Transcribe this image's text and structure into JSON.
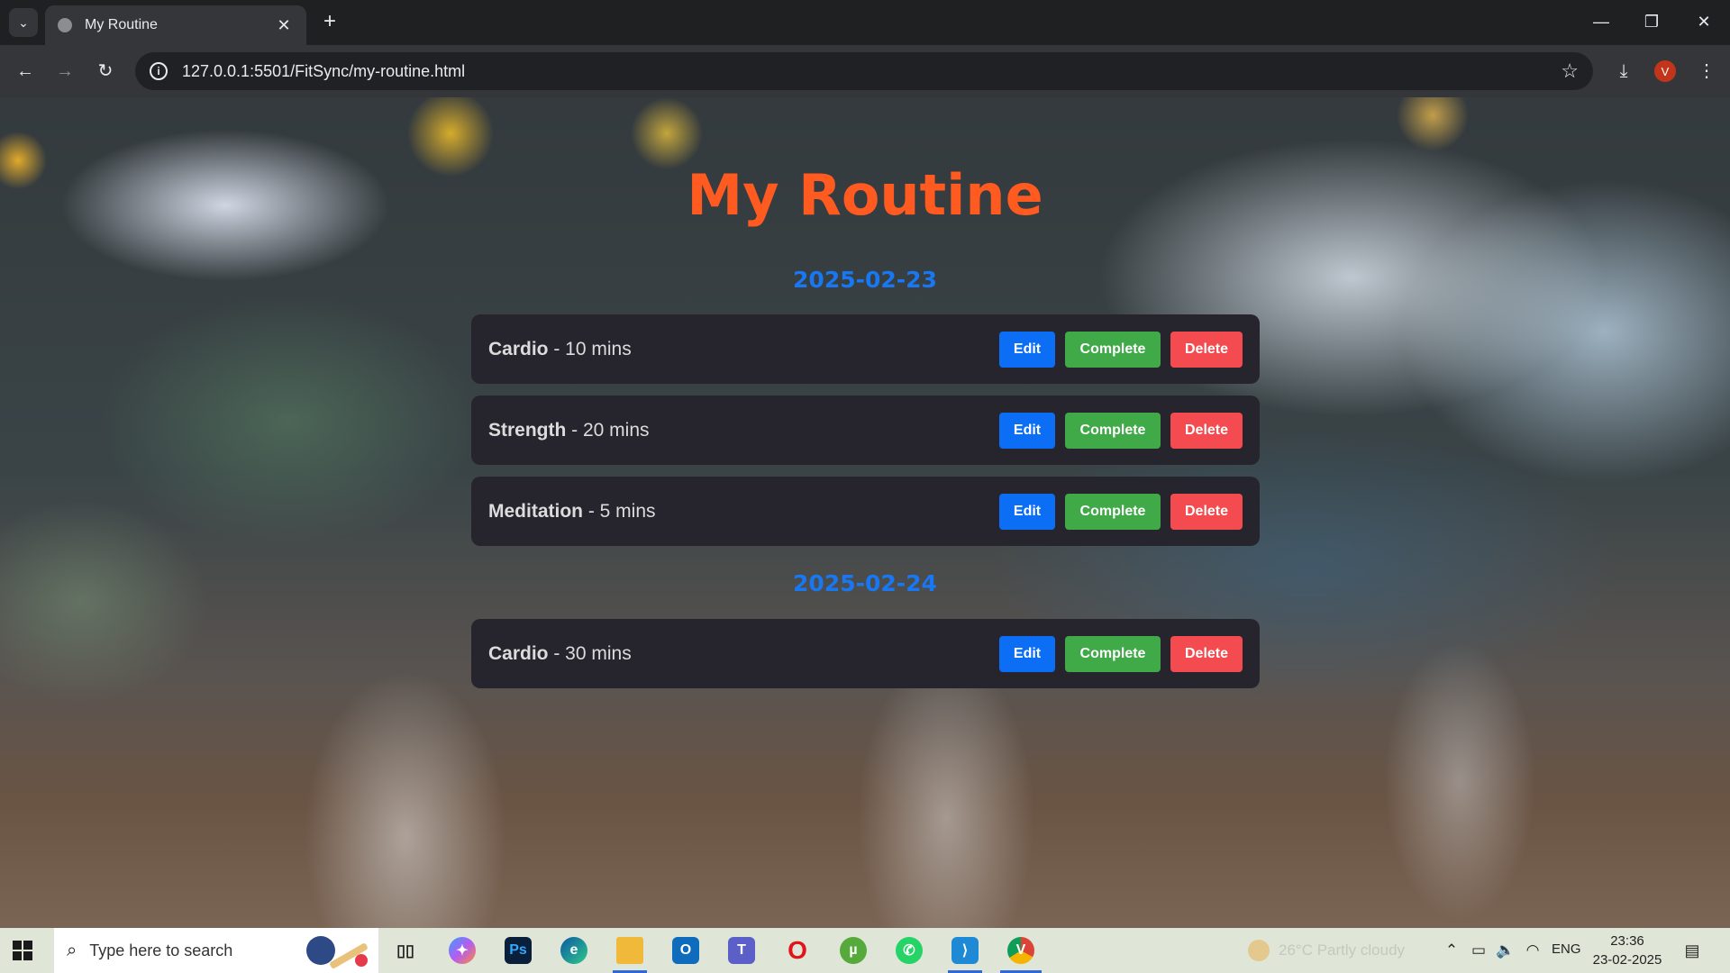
{
  "browser": {
    "tab_title": "My Routine",
    "url": "127.0.0.1:5501/FitSync/my-routine.html",
    "profile_initial": "V"
  },
  "page": {
    "title": "My Routine",
    "buttons": {
      "edit": "Edit",
      "complete": "Complete",
      "delete": "Delete"
    },
    "days": [
      {
        "date": "2025-02-23",
        "routines": [
          {
            "type": "Cardio",
            "duration": " - 10 mins"
          },
          {
            "type": "Strength",
            "duration": " - 20 mins"
          },
          {
            "type": "Meditation",
            "duration": " - 5 mins"
          }
        ]
      },
      {
        "date": "2025-02-24",
        "routines": [
          {
            "type": "Cardio",
            "duration": " - 30 mins"
          }
        ]
      }
    ]
  },
  "taskbar": {
    "search_placeholder": "Type here to search",
    "weather": "26°C  Partly cloudy",
    "language": "ENG",
    "time": "23:36",
    "date": "23-02-2025",
    "apps": [
      {
        "name": "task-view",
        "label": "▯▯",
        "color": "#3b3b3b"
      },
      {
        "name": "copilot",
        "label": "✦",
        "color": "#7a5cf0"
      },
      {
        "name": "photoshop",
        "label": "Ps",
        "color": "#0a1f3a"
      },
      {
        "name": "edge",
        "label": "e",
        "color": "#1e8fd8"
      },
      {
        "name": "file-explorer",
        "label": "▭",
        "color": "#f0b93a"
      },
      {
        "name": "outlook",
        "label": "O",
        "color": "#0f6cbd"
      },
      {
        "name": "teams",
        "label": "T",
        "color": "#5b5fc7"
      },
      {
        "name": "opera",
        "label": "O",
        "color": "#e2141b"
      },
      {
        "name": "utorrent",
        "label": "µ",
        "color": "#56a93b"
      },
      {
        "name": "whatsapp",
        "label": "✆",
        "color": "#25d366"
      },
      {
        "name": "vscode",
        "label": "⟩",
        "color": "#1e8ad6"
      },
      {
        "name": "chrome",
        "label": "V",
        "color": "#db4437"
      }
    ]
  }
}
